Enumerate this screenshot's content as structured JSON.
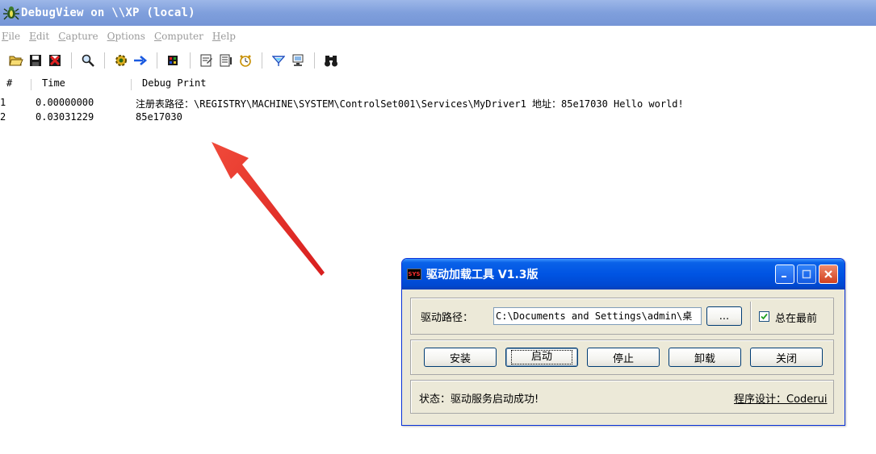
{
  "window": {
    "title": "DebugView on \\\\XP (local)"
  },
  "menu": [
    {
      "mnemonic": "F",
      "rest": "ile"
    },
    {
      "mnemonic": "E",
      "rest": "dit"
    },
    {
      "mnemonic": "C",
      "rest": "apture"
    },
    {
      "mnemonic": "O",
      "rest": "ptions"
    },
    {
      "mnemonic": "C",
      "rest": "omputer"
    },
    {
      "mnemonic": "H",
      "rest": "elp"
    }
  ],
  "toolbar": {
    "icons": [
      "open-icon",
      "save-icon",
      "clear-icon",
      "find-icon",
      "capture-gear-icon",
      "autoscroll-arrow-icon",
      "capture-kernel-icon",
      "filter-icon",
      "history-icon",
      "clock-icon",
      "highlight-icon",
      "computer-icon",
      "binoculars-icon"
    ]
  },
  "list": {
    "columns": [
      "#",
      "Time",
      "Debug Print"
    ],
    "rows": [
      {
        "num": "1",
        "time": "0.00000000",
        "text": "注册表路径：\\REGISTRY\\MACHINE\\SYSTEM\\ControlSet001\\Services\\MyDriver1 地址：85e17030 Hello world!"
      },
      {
        "num": "2",
        "time": "0.03031229",
        "text": "85e17030"
      }
    ]
  },
  "annotation": {
    "arrow_color": "#e8302c"
  },
  "dialog": {
    "title": "驱动加载工具 V1.3版",
    "icon_text": "SYS",
    "path_label": "驱动路径：",
    "path_value": "C:\\Documents and Settings\\admin\\桌",
    "browse_label": "...",
    "always_on_top_label": "总在最前",
    "always_on_top_checked": true,
    "buttons": {
      "install": "安装",
      "start": "启动",
      "stop": "停止",
      "uninstall": "卸载",
      "close": "关闭"
    },
    "status": "状态：驱动服务启动成功!",
    "credit": "程序设计：Coderui"
  },
  "colors": {
    "debugview_title_bg": "#8aa8e0",
    "dialog_title_bg": "#0054e3",
    "dialog_bg": "#ece9d8"
  }
}
